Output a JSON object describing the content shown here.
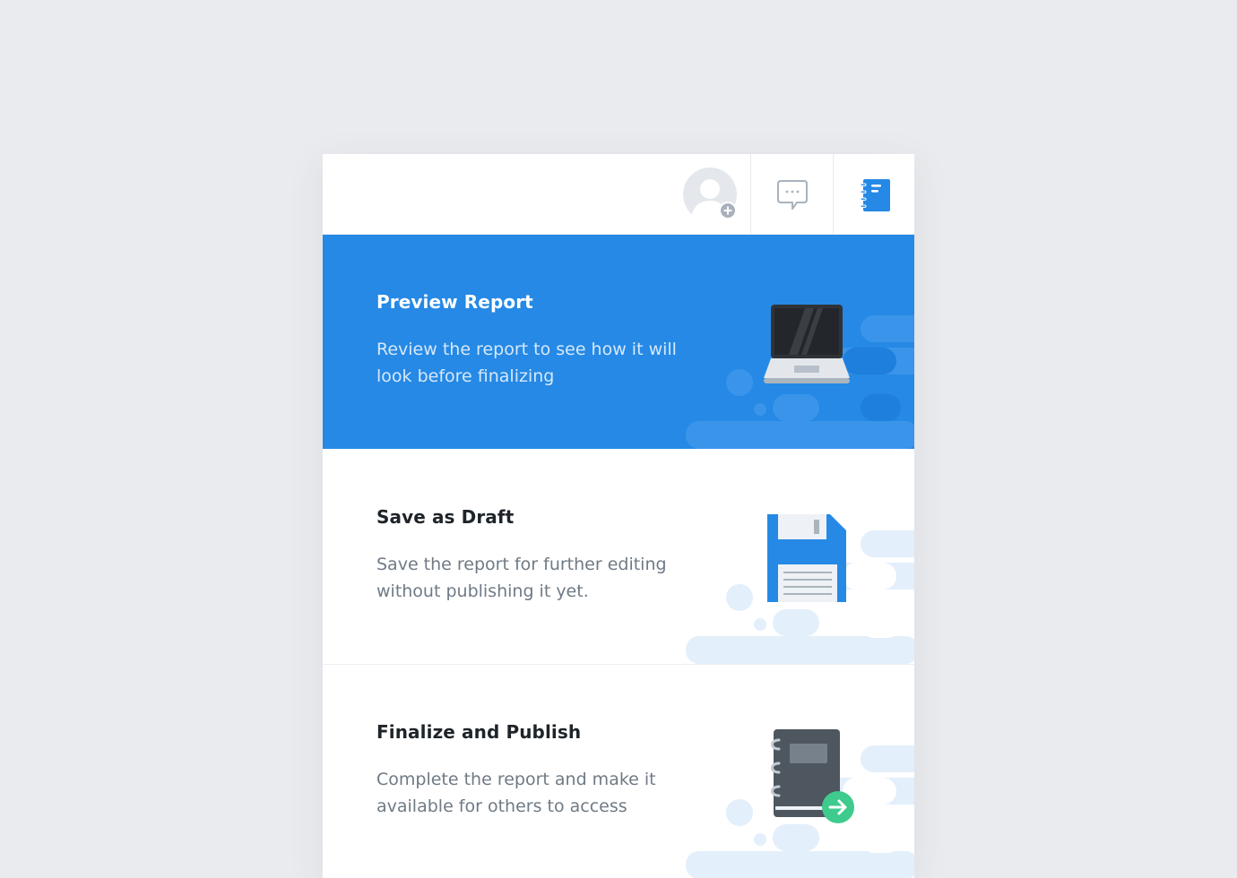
{
  "topbar": {
    "avatar_icon": "user-avatar-add-icon",
    "chat_icon": "chat-bubble-icon",
    "notebook_icon": "notebook-icon",
    "accent_color": "#2589e5"
  },
  "options": [
    {
      "title": "Preview Report",
      "description": "Review the report to see how it will look before finalizing",
      "icon": "laptop-icon",
      "selected": true
    },
    {
      "title": "Save as Draft",
      "description": "Save the report for further editing without publishing it yet.",
      "icon": "floppy-disk-icon",
      "selected": false
    },
    {
      "title": "Finalize and Publish",
      "description": "Complete the report and make it available for others to access",
      "icon": "publish-notebook-icon",
      "selected": false
    }
  ],
  "colors": {
    "selected_bg": "#2589e5",
    "title_text": "#1e2429",
    "body_text": "#6f7a85",
    "publish_arrow": "#3ecb8d"
  }
}
